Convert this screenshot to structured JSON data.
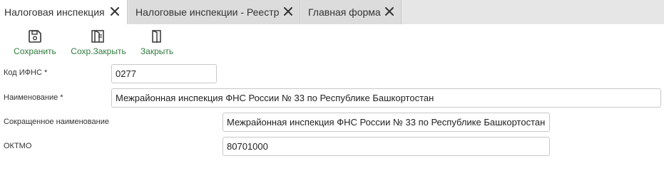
{
  "tabs": [
    {
      "label": "Налоговая инспекция",
      "active": true
    },
    {
      "label": "Налоговые инспекции - Реестр",
      "active": false
    },
    {
      "label": "Главная форма",
      "active": false
    }
  ],
  "toolbar": {
    "save_label": "Сохранить",
    "save_close_label": "Сохр.Закрыть",
    "close_label": "Закрыть",
    "accent_color": "#2f7d3c"
  },
  "form": {
    "ifns_code": {
      "label": "Код ИФНС *",
      "value": "0277"
    },
    "name": {
      "label": "Наименование *",
      "value": "Межрайонная инспекция ФНС России № 33 по Республике Башкортостан"
    },
    "short_name": {
      "label": "Сокращенное наименование",
      "value": "Межрайонная инспекция ФНС России № 33 по Республике Башкортостан"
    },
    "oktmo": {
      "label": "ОКТМО",
      "value": "80701000"
    }
  }
}
